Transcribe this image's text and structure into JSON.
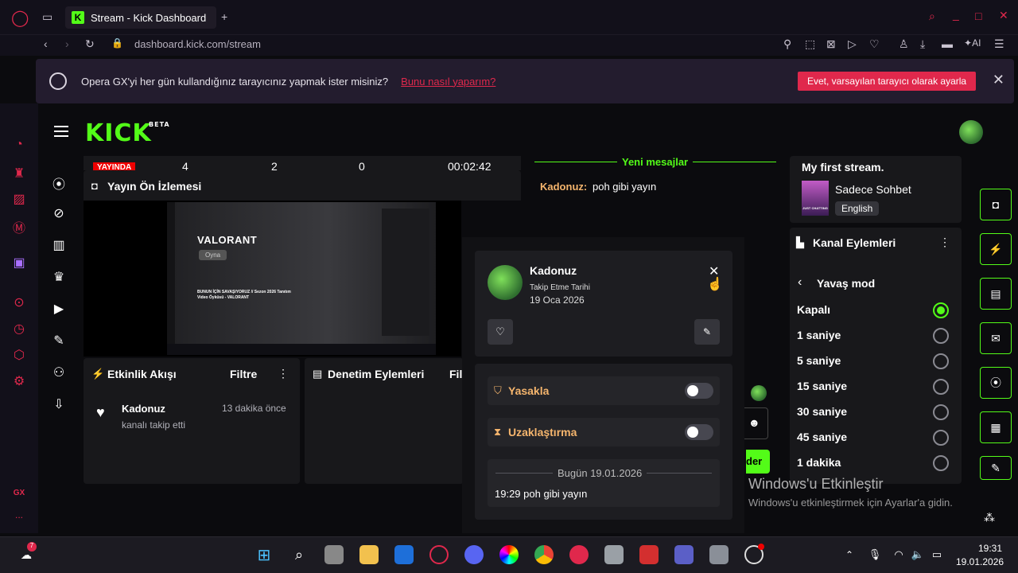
{
  "browser": {
    "tab_title": "Stream - Kick Dashboard",
    "tab_icon": "K",
    "url": "dashboard.kick.com/stream",
    "ai_label": "AI",
    "gx_label": "GX",
    "more_label": "..."
  },
  "infobar": {
    "message": "Opera GX'yi her gün kullandığınız tarayıcınız yapmak ister misiniz?",
    "link": "Bunu nasıl yaparım?",
    "cta": "Evet, varsayılan tarayıcı olarak ayarla"
  },
  "kick": {
    "logo": "KICK",
    "beta": "BETA",
    "stats": {
      "live_badge": "YAYINDA",
      "viewers": "4",
      "followers": "2",
      "third": "0",
      "duration": "00:02:42"
    },
    "preview": {
      "title": "Yayın Ön İzlemesi",
      "game_title": "VALORANT",
      "play_label": "Oyna",
      "video_caption": "BUNUN İÇİN SAVAŞIYORUZ // Sezon 2026 Tanıtım Video Öyküsü - VALORANT"
    },
    "activity": {
      "title": "Etkinlik Akışı",
      "filter": "Filtre",
      "item_user": "Kadonuz",
      "item_time": "13 dakika önce",
      "item_desc": "kanalı takip etti"
    },
    "moderation": {
      "title": "Denetim Eylemleri",
      "filter_partial": "Fil"
    },
    "chat": {
      "new_messages": "Yeni mesajlar",
      "message_user": "Kadonuz:",
      "message_text": "poh gibi yayın",
      "send_partial": "der"
    },
    "user_card": {
      "name": "Kadonuz",
      "follow_label": "Takip Etme Tarihi",
      "follow_date": "19 Oca 2026",
      "ban_label": "Yasakla",
      "timeout_label": "Uzaklaştırma",
      "date_divider": "Bugün 19.01.2026",
      "log_entry": "19:29 poh gibi yayın"
    },
    "stream_info": {
      "title": "My first stream.",
      "category": "Sadece Sohbet",
      "language": "English",
      "thumb_label": "JUST CHATTING"
    },
    "channel_actions": {
      "title": "Kanal Eylemleri",
      "slow_mode": "Yavaş mod",
      "options": [
        "Kapalı",
        "1 saniye",
        "5 saniye",
        "15 saniye",
        "30 saniye",
        "45 saniye",
        "1 dakika"
      ],
      "selected_index": 0
    }
  },
  "windows": {
    "watermark_title": "Windows'u Etkinleştir",
    "watermark_sub": "Windows'u etkinleştirmek için Ayarlar'a gidin.",
    "clock_time": "19:31",
    "clock_date": "19.01.2026",
    "weather_badge": "7"
  },
  "colors": {
    "kick_green": "#53fc18",
    "opera_red": "#e0284c",
    "panel": "#18181b"
  }
}
